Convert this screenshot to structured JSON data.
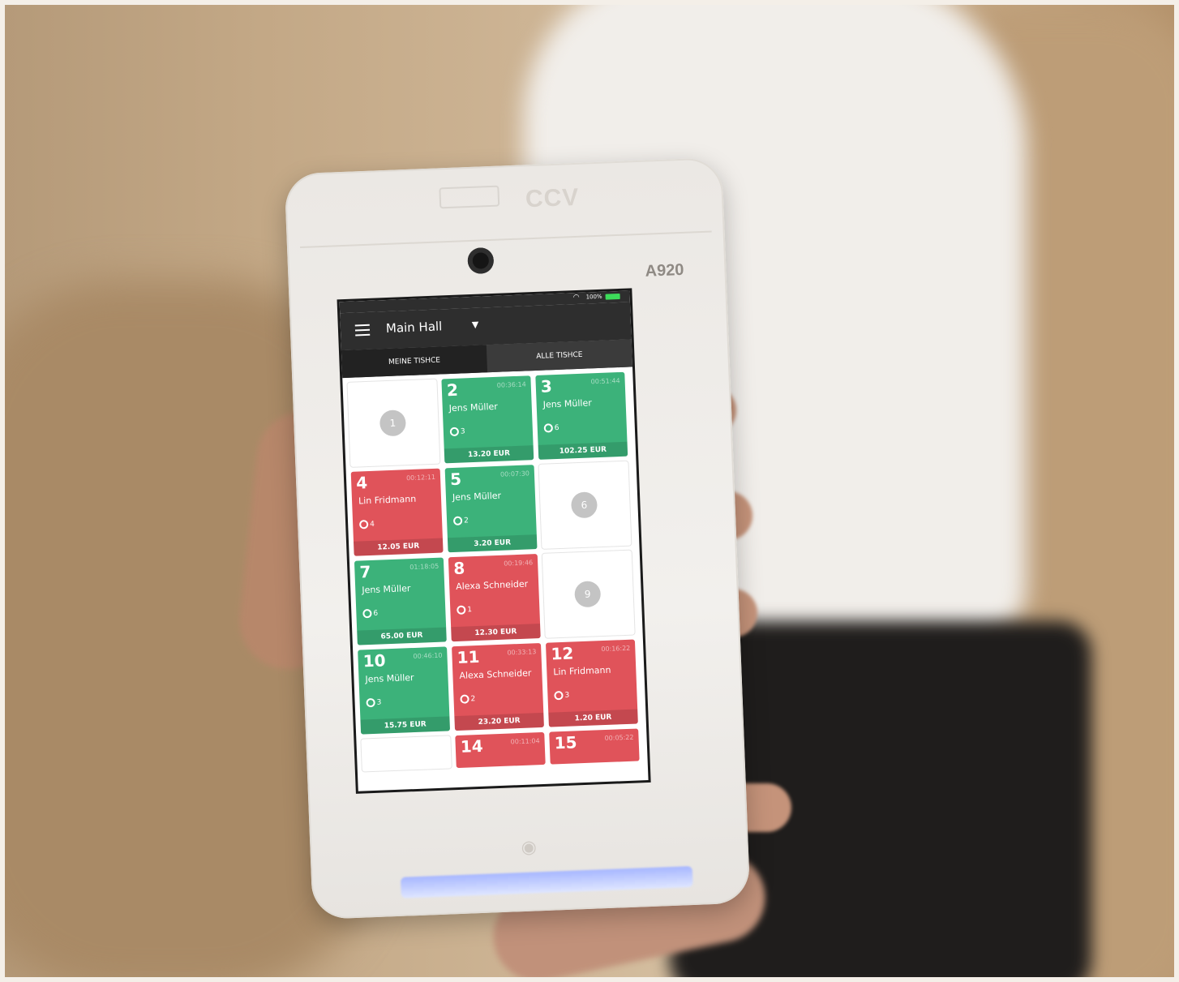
{
  "device": {
    "brand": "CCV",
    "model": "A920"
  },
  "status_bar": {
    "battery_text": "100%",
    "battery_color": "#3ddc5a"
  },
  "app_bar": {
    "title": "Main Hall",
    "caret": "▼"
  },
  "tabs": [
    {
      "label": "MEINE TISHCE",
      "active": true
    },
    {
      "label": "ALLE TISHCE",
      "active": false
    }
  ],
  "colors": {
    "occupied_green": "#3cb27a",
    "occupied_red": "#e0535a",
    "header_dark": "#2e2e2e"
  },
  "tables": [
    {
      "number": "1",
      "state": "empty"
    },
    {
      "number": "2",
      "state": "green",
      "time": "00:36:14",
      "name": "Jens Müller",
      "guests": "3",
      "total": "13.20 EUR"
    },
    {
      "number": "3",
      "state": "green",
      "time": "00:51:44",
      "name": "Jens Müller",
      "guests": "6",
      "total": "102.25 EUR"
    },
    {
      "number": "4",
      "state": "red",
      "time": "00:12:11",
      "name": "Lin Fridmann",
      "guests": "4",
      "total": "12.05 EUR"
    },
    {
      "number": "5",
      "state": "green",
      "time": "00:07:30",
      "name": "Jens Müller",
      "guests": "2",
      "total": "3.20 EUR"
    },
    {
      "number": "6",
      "state": "empty"
    },
    {
      "number": "7",
      "state": "green",
      "time": "01:18:05",
      "name": "Jens Müller",
      "guests": "6",
      "total": "65.00 EUR"
    },
    {
      "number": "8",
      "state": "red",
      "time": "00:19:46",
      "name": "Alexa Schneider",
      "guests": "1",
      "total": "12.30 EUR"
    },
    {
      "number": "9",
      "state": "empty"
    },
    {
      "number": "10",
      "state": "green",
      "time": "00:46:10",
      "name": "Jens Müller",
      "guests": "3",
      "total": "15.75 EUR"
    },
    {
      "number": "11",
      "state": "red",
      "time": "00:33:13",
      "name": "Alexa Schneider",
      "guests": "2",
      "total": "23.20 EUR"
    },
    {
      "number": "12",
      "state": "red",
      "time": "00:16:22",
      "name": "Lin Fridmann",
      "guests": "3",
      "total": "1.20 EUR"
    }
  ],
  "partial_row": [
    {
      "number": "14",
      "state": "red",
      "time": "00:11:04"
    },
    {
      "number": "15",
      "state": "red",
      "time": "00:05:22"
    }
  ]
}
